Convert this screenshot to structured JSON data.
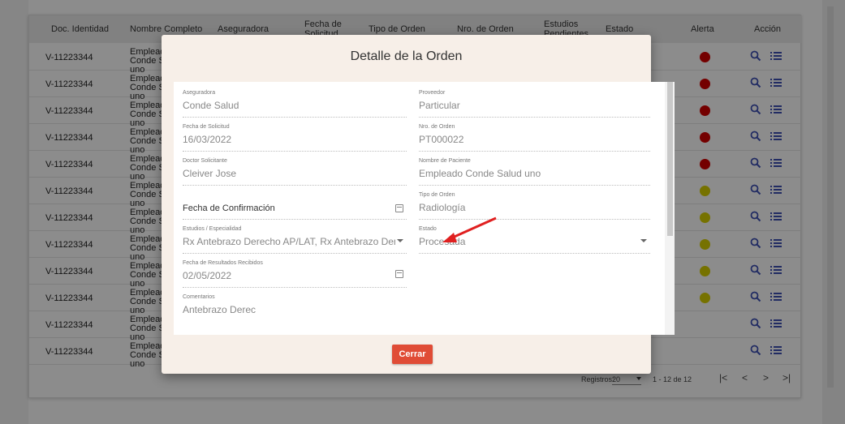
{
  "table": {
    "headers": [
      "Doc. Identidad",
      "Nombre Completo",
      "Aseguradora",
      "Fecha de Solicitud",
      "Tipo de Orden",
      "Nro. de Orden",
      "Estudios Pendientes",
      "Estado",
      "Alerta",
      "Acción"
    ],
    "rows": [
      {
        "doc": "V-11223344",
        "name": "Empleado Conde Salud uno",
        "alert": "#d40000"
      },
      {
        "doc": "V-11223344",
        "name": "Empleado Conde Salud uno",
        "alert": "#d40000"
      },
      {
        "doc": "V-11223344",
        "name": "Empleado Conde Salud uno",
        "alert": "#d40000"
      },
      {
        "doc": "V-11223344",
        "name": "Empleado Conde Salud uno",
        "alert": "#d40000"
      },
      {
        "doc": "V-11223344",
        "name": "Empleado Conde Salud uno",
        "alert": "#d40000"
      },
      {
        "doc": "V-11223344",
        "name": "Empleado Conde Salud uno",
        "alert": "#d8d000"
      },
      {
        "doc": "V-11223344",
        "name": "Empleado Conde Salud uno",
        "alert": "#d8d000"
      },
      {
        "doc": "V-11223344",
        "name": "Empleado Conde Salud uno",
        "alert": "#d8d000"
      },
      {
        "doc": "V-11223344",
        "name": "Empleado Conde Salud uno",
        "alert": "#d8d000"
      },
      {
        "doc": "V-11223344",
        "name": "Empleado Conde Salud uno",
        "alert": "#d8d000"
      },
      {
        "doc": "V-11223344",
        "name": "Empleado Conde Salud uno",
        "alert": ""
      },
      {
        "doc": "V-11223344",
        "name": "Empleado Conde Salud uno",
        "alert": ""
      }
    ]
  },
  "pager": {
    "label": "Registros:",
    "per_page": "20",
    "range": "1 - 12 de 12",
    "first": "|<",
    "prev": "<",
    "next": ">",
    "last": ">|"
  },
  "modal": {
    "title": "Detalle de la Orden",
    "close_label": "Cerrar",
    "fields": {
      "aseguradora": {
        "label": "Aseguradora",
        "value": "Conde Salud"
      },
      "proveedor": {
        "label": "Proveedor",
        "value": "Particular"
      },
      "fecha_solicitud": {
        "label": "Fecha de Solicitud",
        "value": "16/03/2022"
      },
      "nro_orden": {
        "label": "Nro. de Orden",
        "value": "PT000022"
      },
      "doctor": {
        "label": "Doctor Solicitante",
        "value": "Cleiver Jose"
      },
      "paciente": {
        "label": "Nombre de Paciente",
        "value": "Empleado Conde Salud uno"
      },
      "fecha_confirmacion": {
        "placeholder": "Fecha de Confirmación"
      },
      "tipo_orden": {
        "label": "Tipo de Orden",
        "value": "Radiología"
      },
      "estudios": {
        "label": "Estudios / Especialidad",
        "value": "Rx Antebrazo Derecho AP/LAT, Rx Antebrazo Derecho AP"
      },
      "estado": {
        "label": "Estado",
        "value": "Procesada"
      },
      "fecha_resultados": {
        "label": "Fecha de Resultados Recibidos",
        "value": "02/05/2022"
      },
      "comentarios": {
        "label": "Comentarios",
        "value": "Antebrazo Derec"
      }
    }
  },
  "colors": {
    "close_button": "#e04c36",
    "modal_bg": "#f7efe8",
    "annotation_arrow": "#e02020"
  }
}
